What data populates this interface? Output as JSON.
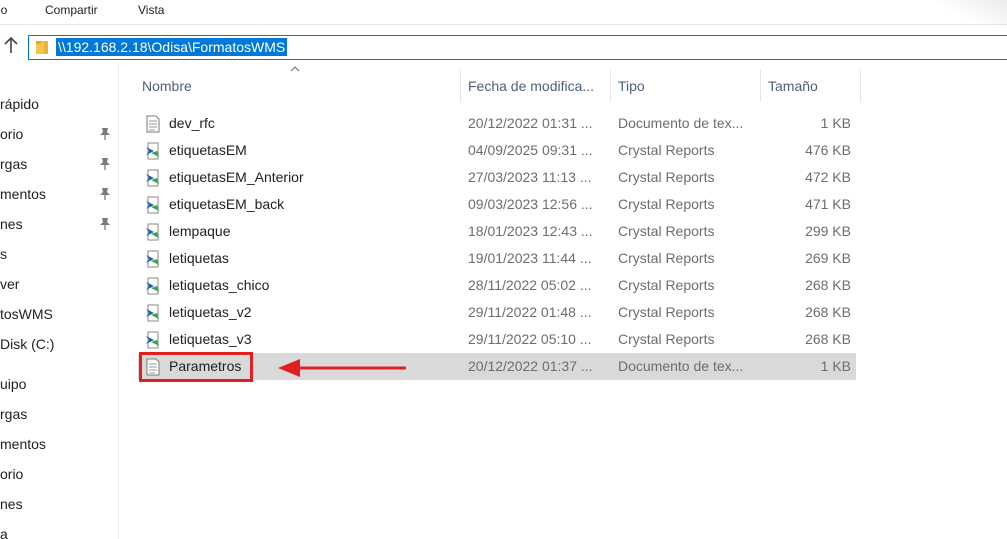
{
  "menu": {
    "item0": "io",
    "item1": "Compartir",
    "item2": "Vista"
  },
  "address": {
    "path": "\\\\192.168.2.18\\Odisa\\FormatosWMS"
  },
  "nav": {
    "items": [
      "rápido",
      "orio",
      "rgas",
      "mentos",
      "nes",
      "s",
      "ver",
      "tosWMS",
      "Disk (C:)",
      "uipo",
      "rgas",
      "mentos",
      "orio",
      "nes",
      "a"
    ]
  },
  "columns": {
    "name": "Nombre",
    "date": "Fecha de modifica...",
    "type": "Tipo",
    "size": "Tamaño"
  },
  "files": [
    {
      "name": "dev_rfc",
      "date": "20/12/2022 01:31 ...",
      "type": "Documento de tex...",
      "size": "1 KB",
      "icon": "text-document-icon"
    },
    {
      "name": "etiquetasEM",
      "date": "04/09/2025 09:31 ...",
      "type": "Crystal Reports",
      "size": "476 KB",
      "icon": "crystal-reports-icon"
    },
    {
      "name": "etiquetasEM_Anterior",
      "date": "27/03/2023 11:13 ...",
      "type": "Crystal Reports",
      "size": "472 KB",
      "icon": "crystal-reports-icon"
    },
    {
      "name": "etiquetasEM_back",
      "date": "09/03/2023 12:56 ...",
      "type": "Crystal Reports",
      "size": "471 KB",
      "icon": "crystal-reports-icon"
    },
    {
      "name": "lempaque",
      "date": "18/01/2023 12:43 ...",
      "type": "Crystal Reports",
      "size": "299 KB",
      "icon": "crystal-reports-icon"
    },
    {
      "name": "letiquetas",
      "date": "19/01/2023 11:44 ...",
      "type": "Crystal Reports",
      "size": "269 KB",
      "icon": "crystal-reports-icon"
    },
    {
      "name": "letiquetas_chico",
      "date": "28/11/2022 05:02 ...",
      "type": "Crystal Reports",
      "size": "268 KB",
      "icon": "crystal-reports-icon"
    },
    {
      "name": "letiquetas_v2",
      "date": "29/11/2022 01:48 ...",
      "type": "Crystal Reports",
      "size": "268 KB",
      "icon": "crystal-reports-icon"
    },
    {
      "name": "letiquetas_v3",
      "date": "29/11/2022 05:10 ...",
      "type": "Crystal Reports",
      "size": "268 KB",
      "icon": "crystal-reports-icon"
    },
    {
      "name": "Parametros",
      "date": "20/12/2022 01:37 ...",
      "type": "Documento de tex...",
      "size": "1 KB",
      "icon": "text-document-icon",
      "selected": true
    }
  ],
  "colors": {
    "accent": "#0078d7",
    "selection": "#d9d9d9",
    "annotation": "#e02020"
  }
}
